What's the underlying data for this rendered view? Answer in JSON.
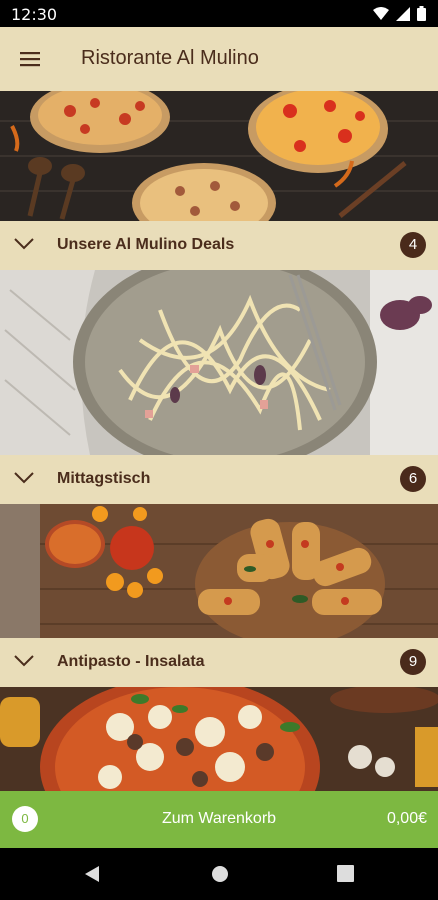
{
  "status_bar": {
    "time": "12:30"
  },
  "app_bar": {
    "title": "Ristorante Al Mulino"
  },
  "categories": [
    {
      "label": "Unsere Al Mulino Deals",
      "count": "4"
    },
    {
      "label": "Mittagstisch",
      "count": "6"
    },
    {
      "label": "Antipasto - Insalata",
      "count": "9"
    }
  ],
  "cart": {
    "count": "0",
    "label": "Zum Warenkorb",
    "total": "0,00€"
  },
  "colors": {
    "accent": "#7db841",
    "bar": "#e9ddb9",
    "badge": "#4a2a1b",
    "text": "#4b2d1c"
  }
}
